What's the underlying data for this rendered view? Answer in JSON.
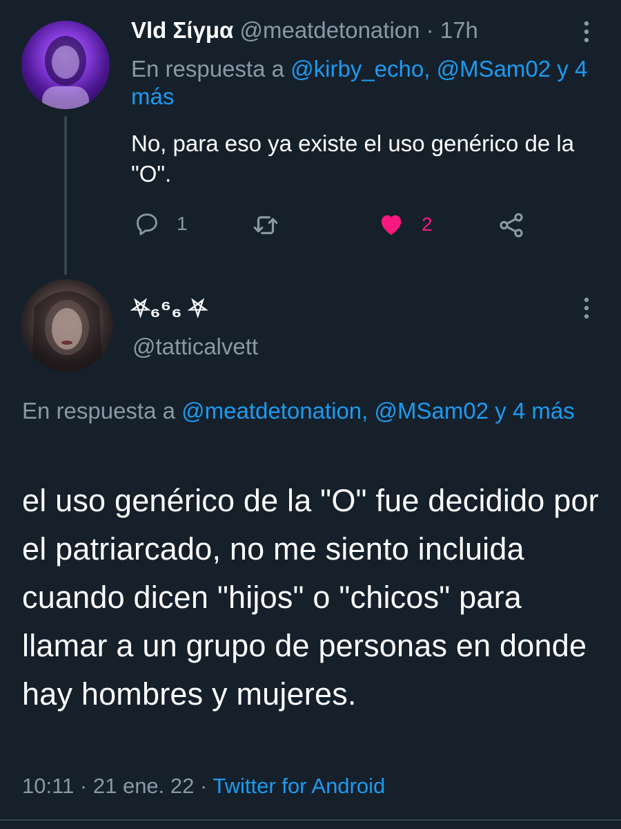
{
  "tweet1": {
    "author_name": "Vld Σίγμα",
    "handle": "@meatdetonation",
    "time": "17h",
    "separator": "·",
    "reply_prefix": "En respuesta a",
    "reply_mentions": "@kirby_echo, @MSam02 y 4 más",
    "text": "No, para eso ya existe el uso genérico de la \"O\".",
    "reply_count": "1",
    "like_count": "2",
    "like_color": "#f91880"
  },
  "tweet2": {
    "author_name": "⛧₆⁶₆ ⛧",
    "handle": "@tatticalvett",
    "reply_prefix": "En respuesta a",
    "reply_mentions": "@meatdetonation, @MSam02 y 4 más",
    "text": "el uso genérico de la \"O\" fue decidido por el patriarcado, no me siento incluida cuando dicen \"hijos\" o \"chicos\" para llamar a un grupo de personas en donde hay hombres y mujeres.",
    "time": "10:11",
    "date": "21 ene. 22",
    "separator": "·",
    "source": "Twitter for Android"
  },
  "icons": [
    "more-vertical-icon",
    "reply-icon",
    "retweet-icon",
    "heart-icon",
    "share-icon"
  ],
  "colors": {
    "background": "#15202b",
    "accent": "#1d9bf0",
    "secondary_text": "#8b98a5"
  }
}
